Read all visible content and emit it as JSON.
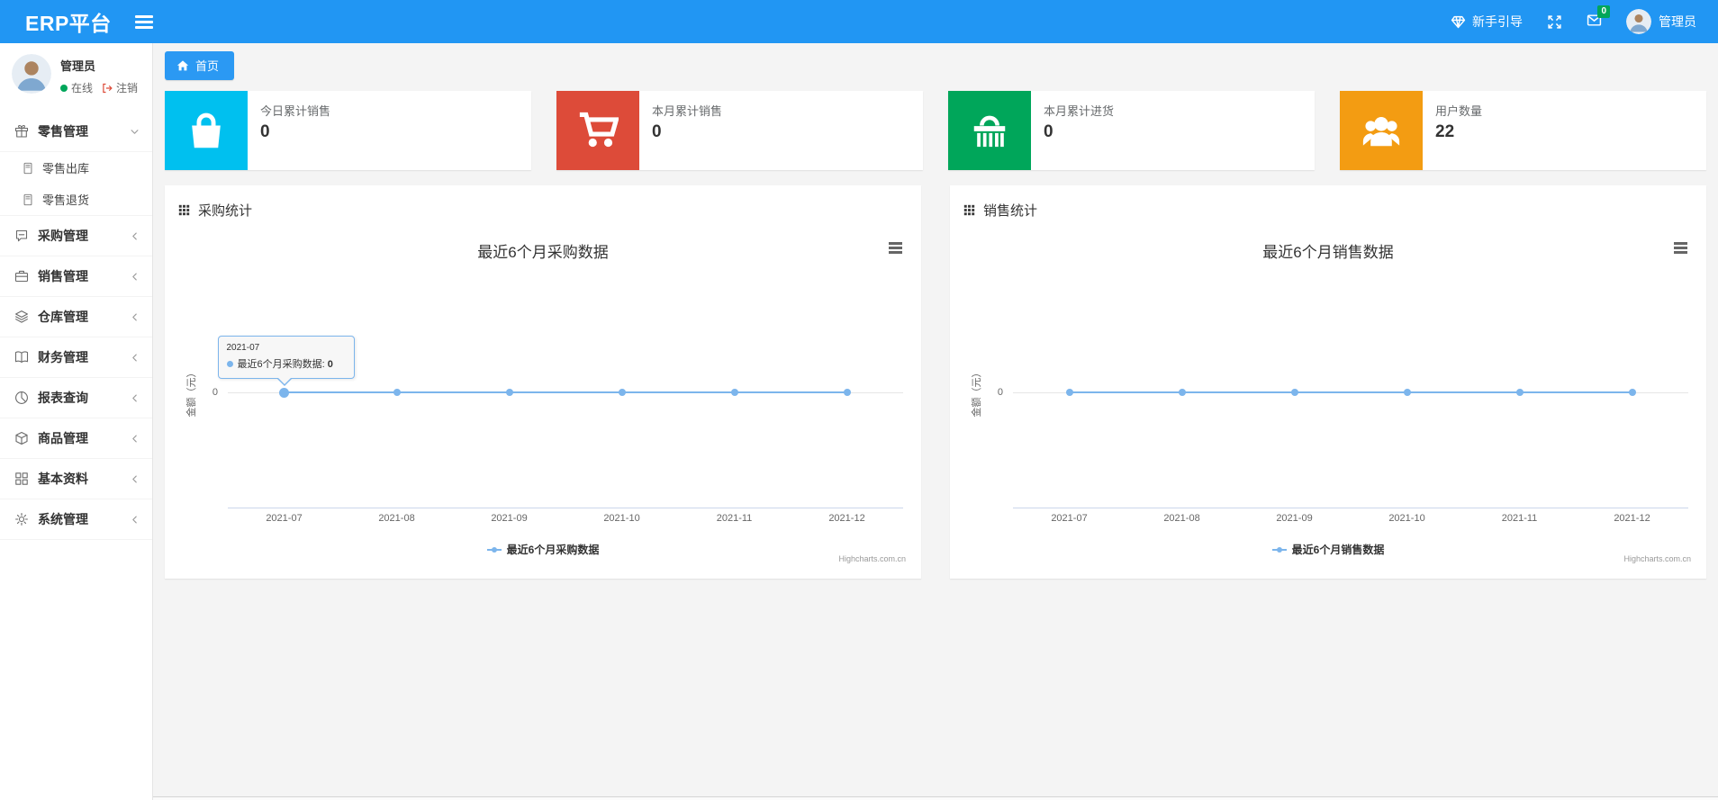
{
  "navbar": {
    "brand": "ERP平台",
    "guide_label": "新手引导",
    "mail_badge": "0",
    "user_name": "管理员"
  },
  "sidebar": {
    "user": {
      "name": "管理员",
      "status": "在线",
      "logout_label": "注销"
    },
    "items": [
      {
        "label": "零售管理",
        "icon": "gift-icon",
        "expanded": true,
        "children": [
          {
            "label": "零售出库",
            "icon": "journal-icon"
          },
          {
            "label": "零售退货",
            "icon": "journal-icon"
          }
        ]
      },
      {
        "label": "采购管理",
        "icon": "chat-square-icon"
      },
      {
        "label": "销售管理",
        "icon": "briefcase-icon"
      },
      {
        "label": "仓库管理",
        "icon": "layers-icon"
      },
      {
        "label": "财务管理",
        "icon": "book-open-icon"
      },
      {
        "label": "报表查询",
        "icon": "pie-chart-icon"
      },
      {
        "label": "商品管理",
        "icon": "box-icon"
      },
      {
        "label": "基本资料",
        "icon": "grid-icon"
      },
      {
        "label": "系统管理",
        "icon": "gear-icon"
      }
    ]
  },
  "breadcrumb": {
    "home_label": "首页"
  },
  "stat_cards": [
    {
      "label": "今日累计销售",
      "value": "0",
      "color": "#00c0ef",
      "icon": "bag-icon"
    },
    {
      "label": "本月累计销售",
      "value": "0",
      "color": "#dd4b39",
      "icon": "cart-icon"
    },
    {
      "label": "本月累计进货",
      "value": "0",
      "color": "#00a65a",
      "icon": "basket-icon"
    },
    {
      "label": "用户数量",
      "value": "22",
      "color": "#f39c12",
      "icon": "users-icon"
    }
  ],
  "panels": [
    {
      "header": "采购统计"
    },
    {
      "header": "销售统计"
    }
  ],
  "chart_data": [
    {
      "type": "line",
      "title": "最近6个月采购数据",
      "categories": [
        "2021-07",
        "2021-08",
        "2021-09",
        "2021-10",
        "2021-11",
        "2021-12"
      ],
      "series": [
        {
          "name": "最近6个月采购数据",
          "values": [
            0,
            0,
            0,
            0,
            0,
            0
          ],
          "color": "#7cb5ec"
        }
      ],
      "xlabel": "",
      "ylabel": "金额（元）",
      "yticks": [
        "0"
      ],
      "ylim": [
        -1,
        1
      ],
      "grid": true,
      "legend_position": "bottom",
      "credit": "Highcharts.com.cn",
      "tooltip": {
        "visible": true,
        "point_index": 0,
        "header": "2021-07",
        "series_label": "最近6个月采购数据",
        "separator": ": ",
        "value": "0"
      }
    },
    {
      "type": "line",
      "title": "最近6个月销售数据",
      "categories": [
        "2021-07",
        "2021-08",
        "2021-09",
        "2021-10",
        "2021-11",
        "2021-12"
      ],
      "series": [
        {
          "name": "最近6个月销售数据",
          "values": [
            0,
            0,
            0,
            0,
            0,
            0
          ],
          "color": "#7cb5ec"
        }
      ],
      "xlabel": "",
      "ylabel": "金额（元）",
      "yticks": [
        "0"
      ],
      "ylim": [
        -1,
        1
      ],
      "grid": true,
      "legend_position": "bottom",
      "credit": "Highcharts.com.cn",
      "tooltip": {
        "visible": false
      }
    }
  ]
}
